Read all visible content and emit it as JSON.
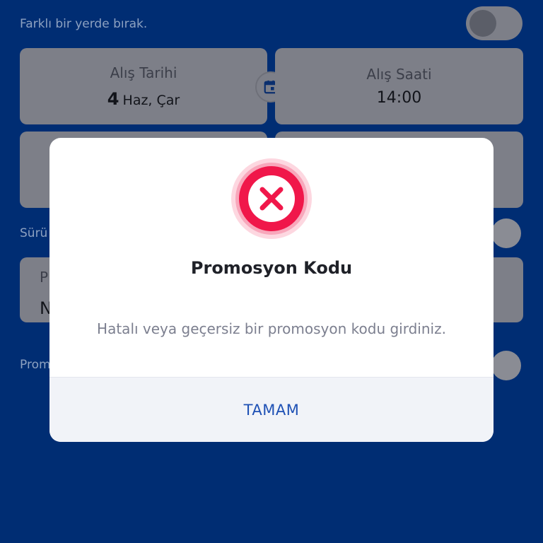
{
  "background": {
    "return_elsewhere_label": "Farklı bir yerde bırak.",
    "driver_label_partial": "Sürü",
    "promo_label_partial": "Prom",
    "field_label_partial": "P",
    "field_value_partial": "N",
    "pickup_date": {
      "label": "Alış Tarihi",
      "day": "4",
      "month_weekday": "Haz, Çar"
    },
    "pickup_time": {
      "label": "Alış Saati",
      "value": "14:00"
    }
  },
  "dialog": {
    "icon": "error-x-icon",
    "title": "Promosyon Kodu",
    "message": "Hatalı veya geçersiz bir promosyon kodu girdiniz.",
    "ok_label": "TAMAM"
  },
  "colors": {
    "background": "#002d73",
    "error": "#f0174a",
    "button_text": "#1f51b5"
  }
}
